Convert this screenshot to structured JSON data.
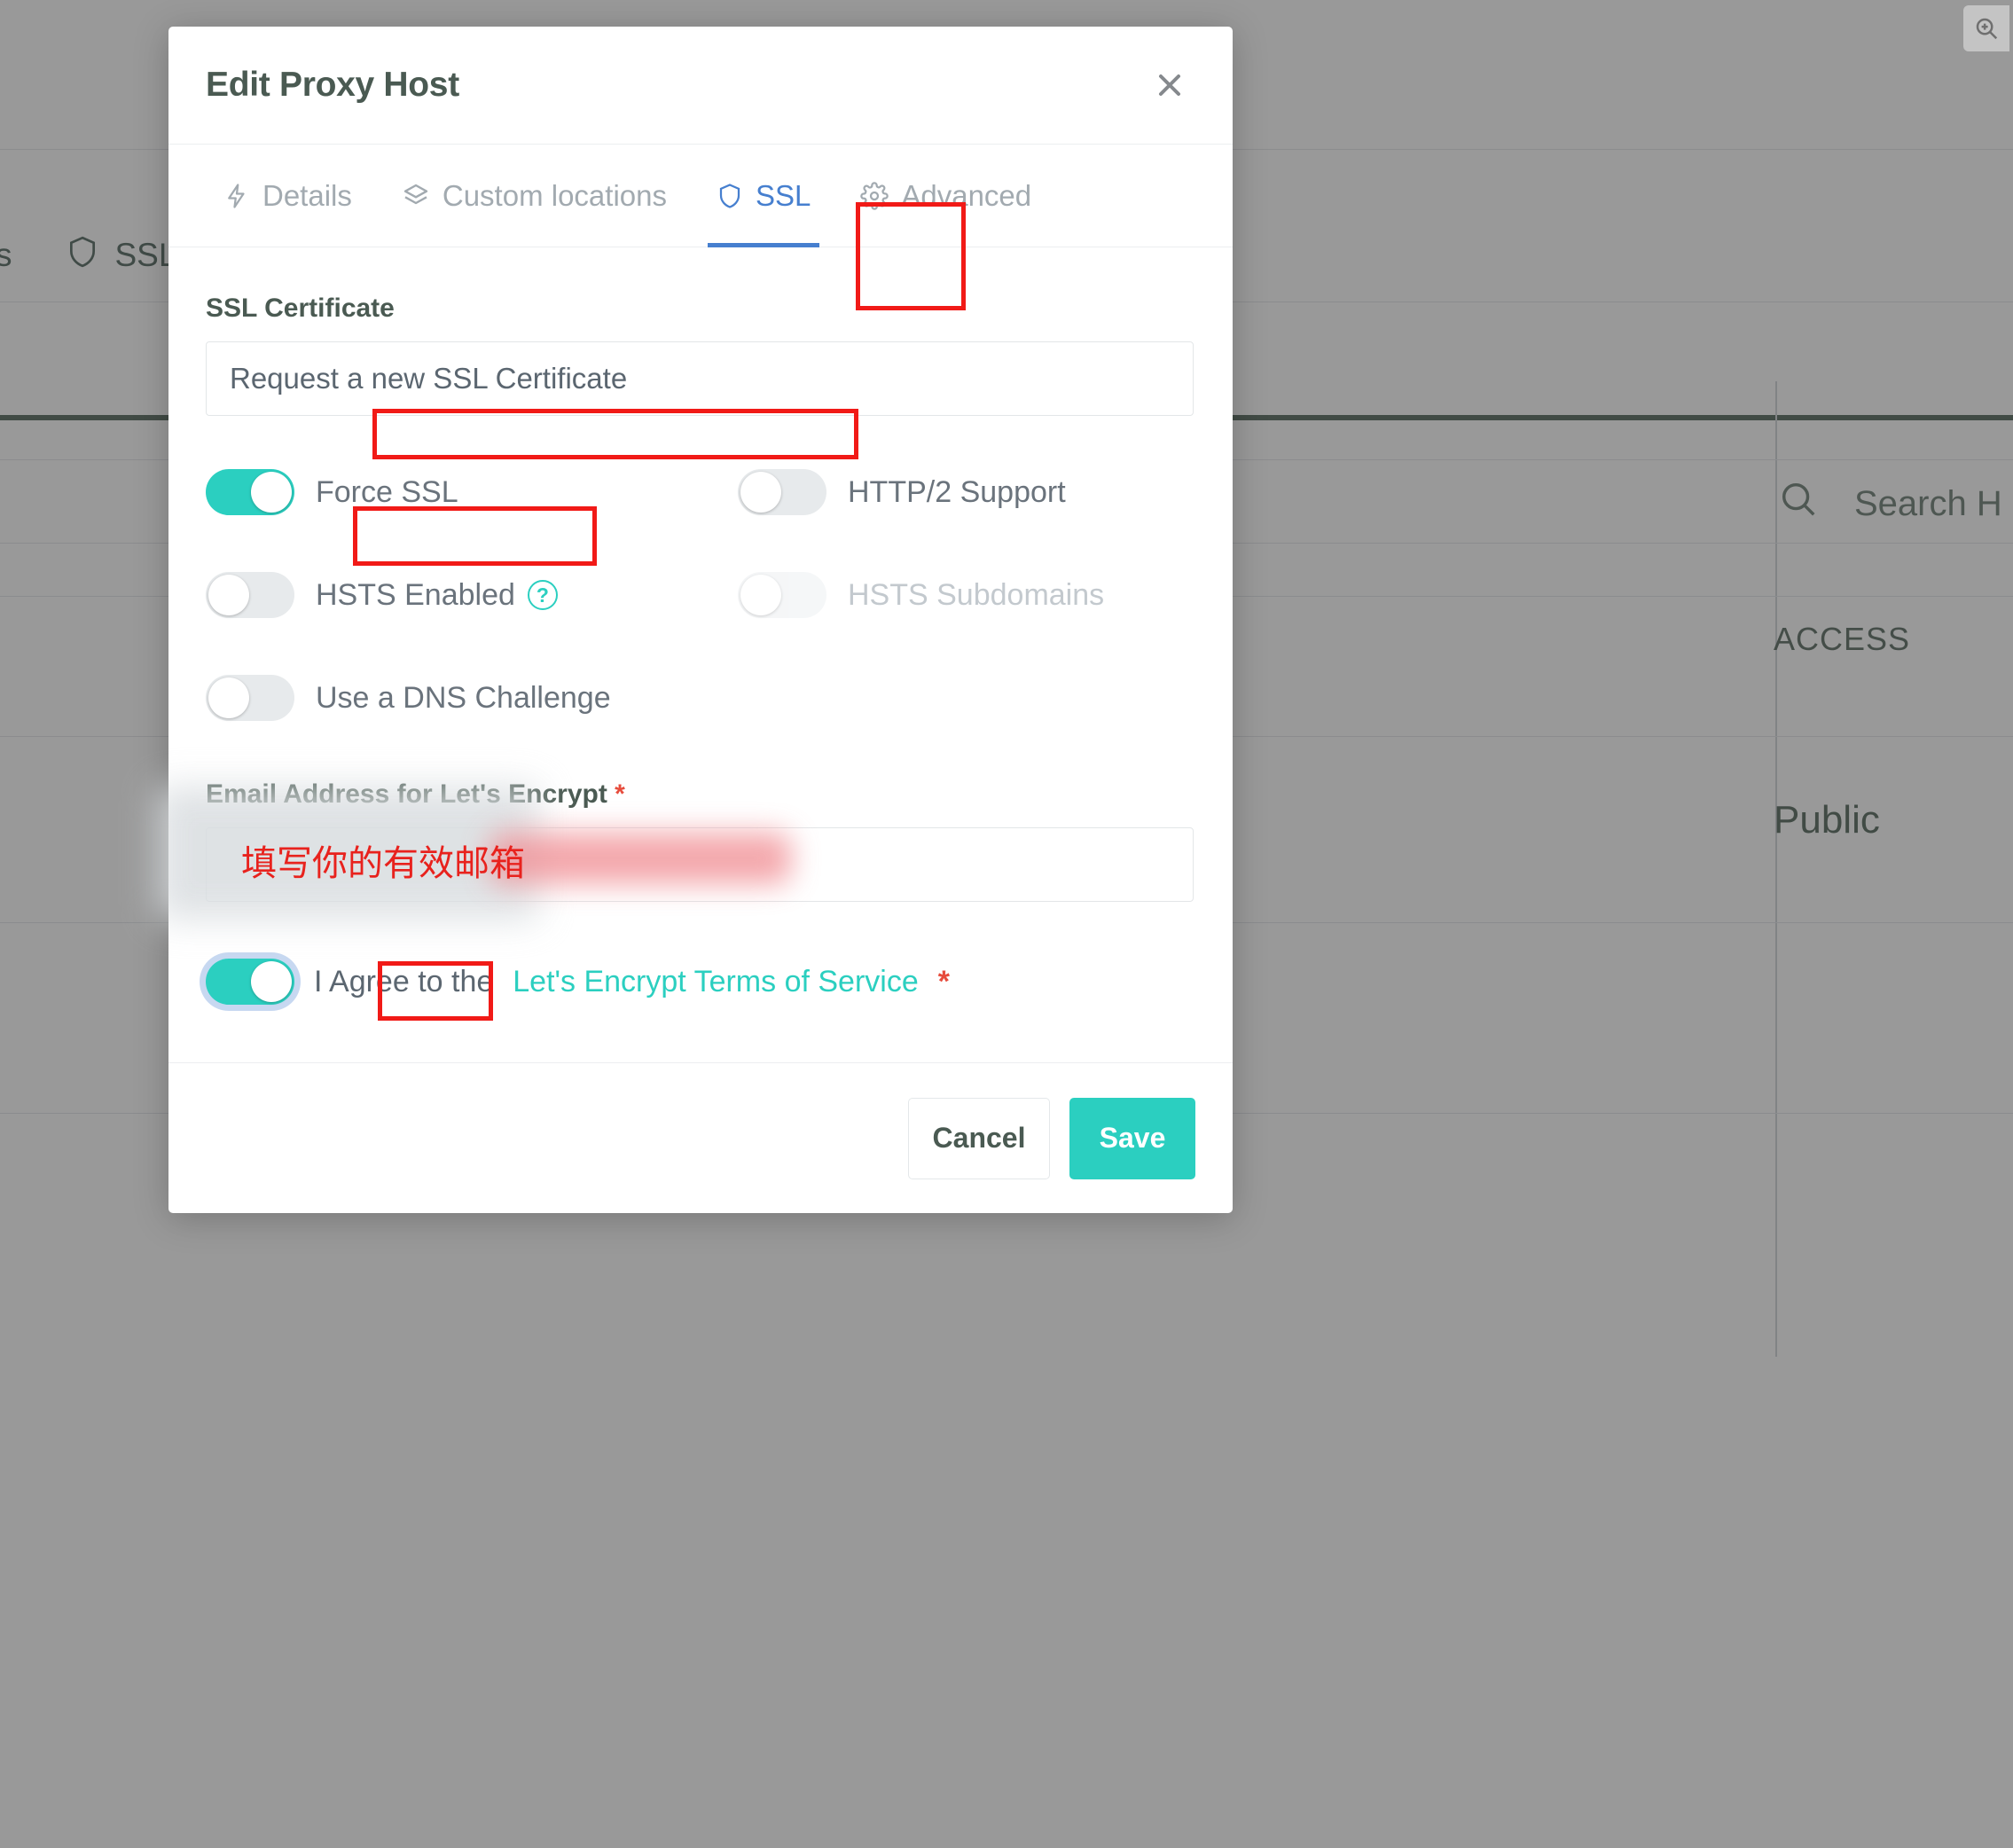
{
  "background": {
    "nav_items": [
      {
        "label": "ists",
        "icon": ""
      },
      {
        "label": "SSL",
        "icon": "shield-icon"
      }
    ],
    "search_placeholder": "Search H",
    "search_icon": "search-icon",
    "access_label": "ACCESS",
    "public_label": "Public",
    "zoom_badge_icon": "zoom-in-icon"
  },
  "modal": {
    "title": "Edit Proxy Host",
    "close_icon": "close-icon",
    "tabs": [
      {
        "label": "Details",
        "icon": "lightning-bolt-icon",
        "active": false
      },
      {
        "label": "Custom locations",
        "icon": "layers-icon",
        "active": false
      },
      {
        "label": "SSL",
        "icon": "shield-icon",
        "active": true
      },
      {
        "label": "Advanced",
        "icon": "gear-icon",
        "active": false
      }
    ],
    "ssl_certificate": {
      "label": "SSL Certificate",
      "selected_option": "Request a new SSL Certificate"
    },
    "toggles": [
      {
        "label": "Force SSL",
        "state": "on",
        "disabled": false,
        "help": false
      },
      {
        "label": "HTTP/2 Support",
        "state": "off",
        "disabled": false,
        "help": false
      },
      {
        "label": "HSTS Enabled",
        "state": "off",
        "disabled": false,
        "help": true
      },
      {
        "label": "HSTS Subdomains",
        "state": "off",
        "disabled": true,
        "help": false
      },
      {
        "label": "Use a DNS Challenge",
        "state": "off",
        "disabled": false,
        "help": false
      }
    ],
    "help_icon_glyph": "?",
    "email": {
      "label": "Email Address for Let's Encrypt",
      "required_mark": "*",
      "value": "",
      "redacted": true
    },
    "agree": {
      "state": "on",
      "prefix": "I Agree to the",
      "link_text": "Let's Encrypt Terms of Service",
      "required_mark": "*"
    },
    "footer": {
      "cancel_label": "Cancel",
      "save_label": "Save"
    }
  },
  "annotations": {
    "chinese_note": "填写你的有效邮箱",
    "box_color": "#f11a17",
    "boxes": [
      "ssl-tab",
      "ssl-certificate-value",
      "force-ssl-toggle",
      "agree-toggle"
    ]
  },
  "colors": {
    "accent_teal": "#2bcfc0",
    "active_tab_blue": "#467fcf",
    "required_red": "#e74c3c",
    "annotation_red": "#f11a17",
    "title_text": "#4a5a52"
  }
}
